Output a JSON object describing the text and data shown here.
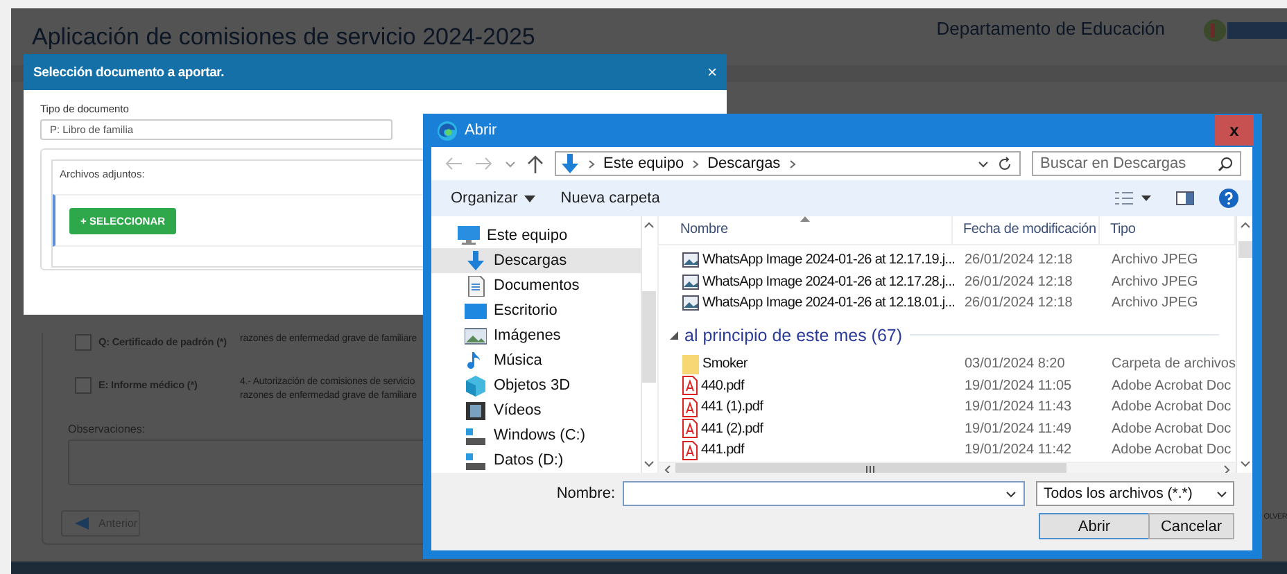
{
  "background_app": {
    "title": "Aplicación de comisiones de servicio 2024-2025",
    "department": "Departamento de Educación",
    "documents": [
      {
        "label": "Q: Certificado de padrón (*)",
        "checked": false,
        "description": [
          "razones de enfermedad grave de familiare"
        ]
      },
      {
        "label": "E: Informe médico (*)",
        "checked": false,
        "description": [
          "4.- Autorización de comisiones de servicio",
          "razones de enfermedad grave de familiare"
        ]
      }
    ],
    "observations_label": "Observaciones:",
    "back_button": "Anterior",
    "cut_button": "OLVER"
  },
  "modal": {
    "title": "Selección documento a aportar.",
    "close": "×",
    "doc_type_label": "Tipo de documento",
    "doc_type_value": "P: Libro de familia",
    "attachments_label": "Archivos adjuntos:",
    "select_button": "+ SELECCIONAR"
  },
  "file_dialog": {
    "title": "Abrir",
    "close": "x",
    "path": [
      "Este equipo",
      "Descargas"
    ],
    "search": {
      "placeholder": "Buscar en Descargas"
    },
    "toolbar": {
      "organize": "Organizar",
      "new_folder": "Nueva carpeta"
    },
    "nav": [
      {
        "label": "Este equipo",
        "kind": "computer",
        "selected": false,
        "children": [
          {
            "label": "Descargas",
            "kind": "download",
            "selected": true
          },
          {
            "label": "Documentos",
            "kind": "document",
            "selected": false
          },
          {
            "label": "Escritorio",
            "kind": "desktop",
            "selected": false
          },
          {
            "label": "Imágenes",
            "kind": "image",
            "selected": false
          },
          {
            "label": "Música",
            "kind": "music",
            "selected": false
          },
          {
            "label": "Objetos 3D",
            "kind": "cube",
            "selected": false
          },
          {
            "label": "Vídeos",
            "kind": "video",
            "selected": false
          },
          {
            "label": "Windows (C:)",
            "kind": "drive",
            "selected": false
          },
          {
            "label": "Datos (D:)",
            "kind": "drive",
            "selected": false
          }
        ]
      }
    ],
    "columns": [
      "Nombre",
      "Fecha de modificación",
      "Tipo"
    ],
    "rows": [
      {
        "kind": "image",
        "name": "WhatsApp Image 2024-01-26 at 12.17.19.j...",
        "date": "26/01/2024 12:18",
        "type": "Archivo JPEG"
      },
      {
        "kind": "image",
        "name": "WhatsApp Image 2024-01-26 at 12.17.28.j...",
        "date": "26/01/2024 12:18",
        "type": "Archivo JPEG"
      },
      {
        "kind": "image",
        "name": "WhatsApp Image 2024-01-26 at 12.18.01.j...",
        "date": "26/01/2024 12:18",
        "type": "Archivo JPEG"
      },
      {
        "kind": "group",
        "name": "al principio de este mes (67)"
      },
      {
        "kind": "folder",
        "name": "Smoker",
        "date": "03/01/2024 8:20",
        "type": "Carpeta de archivos"
      },
      {
        "kind": "pdf",
        "name": "440.pdf",
        "date": "19/01/2024 11:05",
        "type": "Adobe Acrobat Doc"
      },
      {
        "kind": "pdf",
        "name": "441 (1).pdf",
        "date": "19/01/2024 11:43",
        "type": "Adobe Acrobat Doc"
      },
      {
        "kind": "pdf",
        "name": "441 (2).pdf",
        "date": "19/01/2024 11:49",
        "type": "Adobe Acrobat Doc"
      },
      {
        "kind": "pdf",
        "name": "441.pdf",
        "date": "19/01/2024 11:42",
        "type": "Adobe Acrobat Doc"
      }
    ],
    "filename_label": "Nombre:",
    "filter": "Todos los archivos (*.*)",
    "open_button": "Abrir",
    "cancel_button": "Cancelar"
  }
}
